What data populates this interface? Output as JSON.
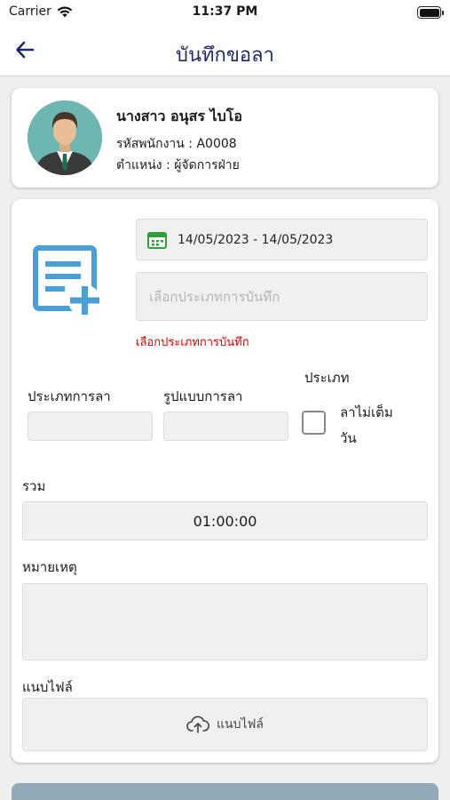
{
  "status_bar": {
    "carrier": "Carrier",
    "time": "11:37 PM"
  },
  "nav": {
    "title": "บันทึกขอลา"
  },
  "profile": {
    "name": "นางสาว อนุสร ไบโอ",
    "employee_id": "รหัสพนักงาน : A0008",
    "position": "ตำแหน่ง : ผู้จัดการฝ่าย"
  },
  "form": {
    "date_range": "14/05/2023 - 14/05/2023",
    "record_type_placeholder": "เลือกประเภทการบันทึก",
    "record_type_error": "เลือกประเภทการบันทึก",
    "leave_type_label": "ประเภทการลา",
    "leave_format_label": "รูปแบบการลา",
    "category_label": "ประเภท",
    "partial_day_label_line1": "ลาไม่เต็ม",
    "partial_day_label_line2": "วัน",
    "total_label": "รวม",
    "total_value": "01:00:00",
    "note_label": "หมายเหตุ",
    "attach_label": "แนบไฟล์",
    "attach_button_label": "แนบไฟล์"
  },
  "colors": {
    "title": "#1f2a6a",
    "error": "#e10000",
    "icon_blue": "#4a9fd5",
    "calendar_green": "#2e9e3a",
    "submit_button": "#91a9b9"
  },
  "icons": [
    "wifi-icon",
    "battery-icon",
    "back-arrow-icon",
    "avatar",
    "document-add-icon",
    "calendar-icon",
    "cloud-upload-icon"
  ]
}
